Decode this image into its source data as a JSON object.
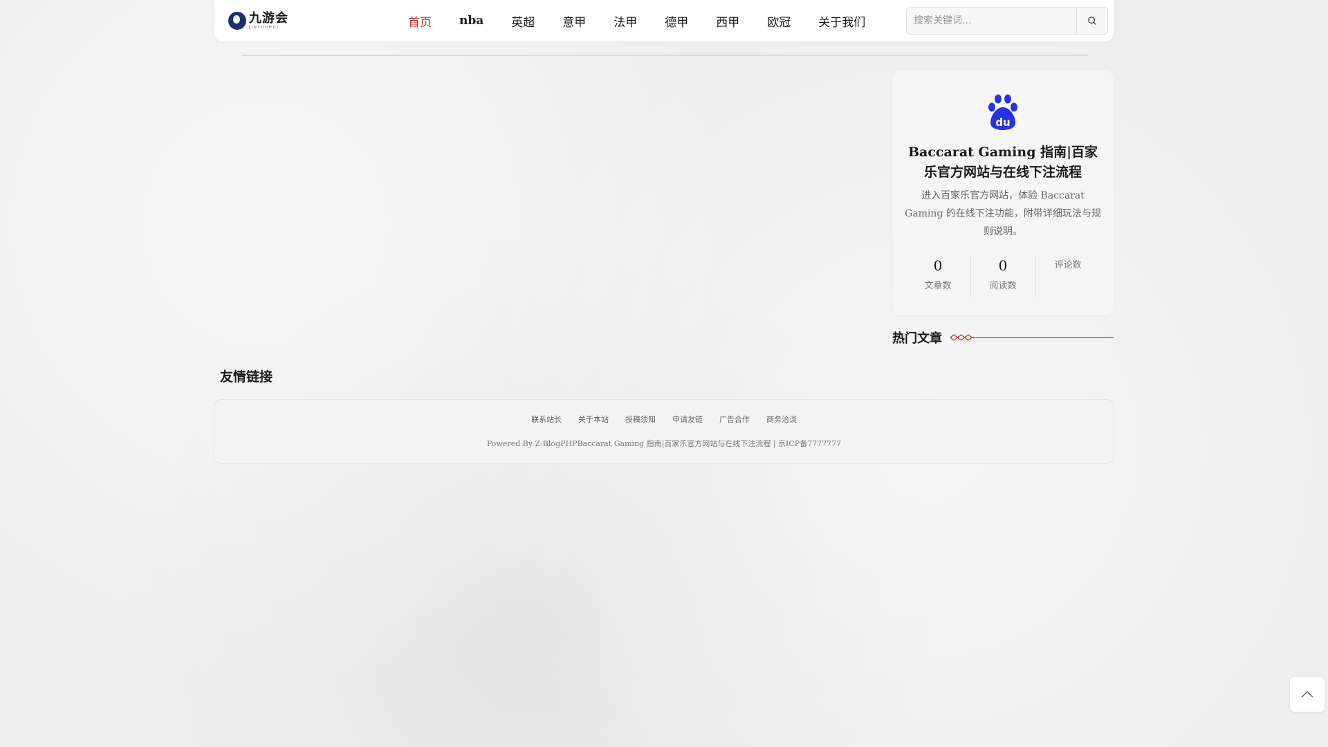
{
  "logo": {
    "cn": "九游会",
    "en": "JIUYOUHUI"
  },
  "nav": [
    {
      "label": "首页",
      "active": true
    },
    {
      "label": "nba",
      "active": false
    },
    {
      "label": "英超",
      "active": false
    },
    {
      "label": "意甲",
      "active": false
    },
    {
      "label": "法甲",
      "active": false
    },
    {
      "label": "德甲",
      "active": false
    },
    {
      "label": "西甲",
      "active": false
    },
    {
      "label": "欧冠",
      "active": false
    },
    {
      "label": "关于我们",
      "active": false
    }
  ],
  "search": {
    "placeholder": "搜索关键词..."
  },
  "profile": {
    "icon": "baidu-paw-icon",
    "title": "Baccarat Gaming 指南|百家乐官方网站与在线下注流程",
    "description": "进入百家乐官方网站，体验 Baccarat Gaming 的在线下注功能，附带详细玩法与规则说明。",
    "stats": [
      {
        "value": "0",
        "label": "文章数"
      },
      {
        "value": "0",
        "label": "阅读数"
      },
      {
        "value": "",
        "label": "评论数"
      }
    ]
  },
  "hot": {
    "title": "热门文章"
  },
  "friend_links": {
    "title": "友情链接"
  },
  "footer": {
    "links": [
      "联系站长",
      "关于本站",
      "投稿须知",
      "申请友链",
      "广告合作",
      "商务洽谈"
    ],
    "copyright": "Powered By Z-BlogPHPBaccarat Gaming 指南|百家乐官方网站与在线下注流程 | 京ICP备7777777"
  },
  "colors": {
    "accent": "#c0392b",
    "brand": "#1d2f6b",
    "baidu_blue": "#2932e1"
  }
}
